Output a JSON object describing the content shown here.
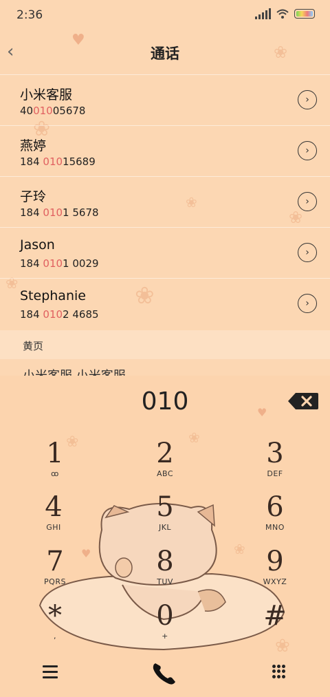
{
  "status_bar": {
    "time": "2:36"
  },
  "header": {
    "title": "通话",
    "back_label": "‹"
  },
  "contacts": [
    {
      "name": "小米客服",
      "num_pre": "40",
      "num_hl": "010",
      "num_post": "05678"
    },
    {
      "name": "燕婷",
      "num_pre": "184 ",
      "num_hl": "010",
      "num_post": "15689"
    },
    {
      "name": "子玲",
      "num_pre": "184 ",
      "num_hl": "010",
      "num_post": "1 5678"
    },
    {
      "name": "Jason",
      "num_pre": "184 ",
      "num_hl": "010",
      "num_post": "1 0029"
    },
    {
      "name": "Stephanie",
      "num_pre": "184 ",
      "num_hl": "010",
      "num_post": "2 4685"
    }
  ],
  "section": {
    "yellow_pages": "黄页",
    "cut_off_item": "小米客服 小米客服"
  },
  "dialer": {
    "dialed_number": "010",
    "keys": [
      {
        "digit": "1",
        "sub": "ꝏ"
      },
      {
        "digit": "2",
        "sub": "ABC"
      },
      {
        "digit": "3",
        "sub": "DEF"
      },
      {
        "digit": "4",
        "sub": "GHI"
      },
      {
        "digit": "5",
        "sub": "JKL"
      },
      {
        "digit": "6",
        "sub": "MNO"
      },
      {
        "digit": "7",
        "sub": "PQRS"
      },
      {
        "digit": "8",
        "sub": "TUV"
      },
      {
        "digit": "9",
        "sub": "WXYZ"
      },
      {
        "digit": "*",
        "sub": ","
      },
      {
        "digit": "0",
        "sub": "+"
      },
      {
        "digit": "#",
        "sub": ""
      }
    ]
  },
  "colors": {
    "background": "#fcd7b3",
    "highlight": "#e06060"
  },
  "icons": [
    "signal-icon",
    "wifi-icon",
    "battery-icon",
    "back-arrow-icon",
    "chevron-right-icon",
    "backspace-icon",
    "menu-icon",
    "phone-icon",
    "dialpad-icon"
  ]
}
